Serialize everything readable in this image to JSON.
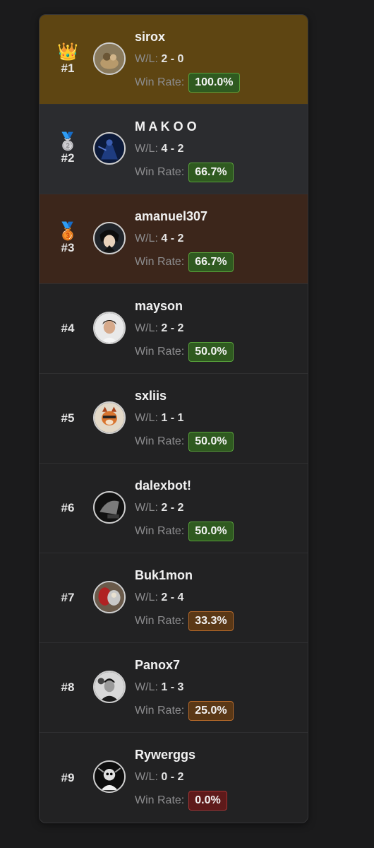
{
  "leaderboard": {
    "wl_label": "W/L:",
    "winrate_label": "Win Rate:",
    "rows": [
      {
        "rank": "#1",
        "medal": "👑",
        "name": "sirox",
        "wl": "2 - 0",
        "win_rate": "100.0%",
        "rate_color": "green",
        "row_color": "gold"
      },
      {
        "rank": "#2",
        "medal": "🥈",
        "name": "M A K O O",
        "wl": "4 - 2",
        "win_rate": "66.7%",
        "rate_color": "green",
        "row_color": "silver"
      },
      {
        "rank": "#3",
        "medal": "🥉",
        "name": "amanuel307",
        "wl": "4 - 2",
        "win_rate": "66.7%",
        "rate_color": "green",
        "row_color": "bronze"
      },
      {
        "rank": "#4",
        "medal": "",
        "name": "mayson",
        "wl": "2 - 2",
        "win_rate": "50.0%",
        "rate_color": "green",
        "row_color": "default"
      },
      {
        "rank": "#5",
        "medal": "",
        "name": "sxliis",
        "wl": "1 - 1",
        "win_rate": "50.0%",
        "rate_color": "green",
        "row_color": "default"
      },
      {
        "rank": "#6",
        "medal": "",
        "name": "dalexbot!",
        "wl": "2 - 2",
        "win_rate": "50.0%",
        "rate_color": "green",
        "row_color": "default"
      },
      {
        "rank": "#7",
        "medal": "",
        "name": "Buk1mon",
        "wl": "2 - 4",
        "win_rate": "33.3%",
        "rate_color": "orange",
        "row_color": "default"
      },
      {
        "rank": "#8",
        "medal": "",
        "name": "Panox7",
        "wl": "1 - 3",
        "win_rate": "25.0%",
        "rate_color": "orange",
        "row_color": "default"
      },
      {
        "rank": "#9",
        "medal": "",
        "name": "Rywerggs",
        "wl": "0 - 2",
        "win_rate": "0.0%",
        "rate_color": "red",
        "row_color": "default"
      }
    ]
  },
  "colors": {
    "gold_row": "#5e4512",
    "silver_row": "#2b2c2f",
    "bronze_row": "#3c261b",
    "green_badge": "#2f5a20",
    "orange_badge": "#5a3816",
    "red_badge": "#5e1a1a"
  }
}
